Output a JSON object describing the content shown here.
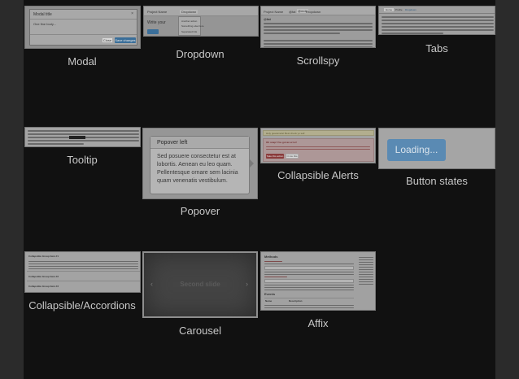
{
  "captions": {
    "modal": "Modal",
    "dropdown": "Dropdown",
    "scrollspy": "Scrollspy",
    "tabs": "Tabs",
    "tooltip": "Tooltip",
    "popover": "Popover",
    "collapsible_alerts": "Collapsible Alerts",
    "button_states": "Button states",
    "accordions": "Collapsible/Accordions",
    "carousel": "Carousel",
    "affix": "Affix"
  },
  "modal": {
    "title": "Modal title",
    "body": "One fine body...",
    "close_label": "Close",
    "save_label": "Save changes"
  },
  "dropdown": {
    "project": "Project Name",
    "dropdown_label": "Dropdown",
    "heading": "Write your",
    "menu_items": [
      "Another action",
      "Something else here",
      "Separated link"
    ]
  },
  "scrollspy": {
    "project": "Project Name",
    "tabs": [
      "@fat",
      "@mdo",
      "Dropdown"
    ],
    "section": "@fat"
  },
  "tabs": {
    "tab_items": [
      "Home",
      "Profile",
      "Dropdown"
    ]
  },
  "popover": {
    "title": "Popover left",
    "body": "Sed posuere consectetur est at lobortis. Aenean eu leo quam. Pellentesque ornare sem lacinia quam venenatis vestibulum."
  },
  "alerts": {
    "warning_text": "Holy guacamole! Best check yo self",
    "error_title": "Oh snap! You got an error!",
    "take_action": "Take this action",
    "or_this": "Or do this"
  },
  "button_states": {
    "loading_label": "Loading..."
  },
  "accordion": {
    "headers": [
      "Collapsible Group Item #1",
      "Collapsible Group Item #2",
      "Collapsible Group Item #3"
    ]
  },
  "carousel": {
    "slide_label": "Second slide",
    "prev": "‹",
    "next": "›"
  },
  "affix": {
    "heading": "Methods",
    "subheading": "Events",
    "col_name": "Name",
    "col_desc": "Description"
  },
  "colors": {
    "panel_bg": "#111111",
    "page_bg": "#2b2b2b",
    "caption": "#c8c8c8",
    "primary_button": "#3a6e99",
    "loading_button": "#5a8ab3"
  }
}
